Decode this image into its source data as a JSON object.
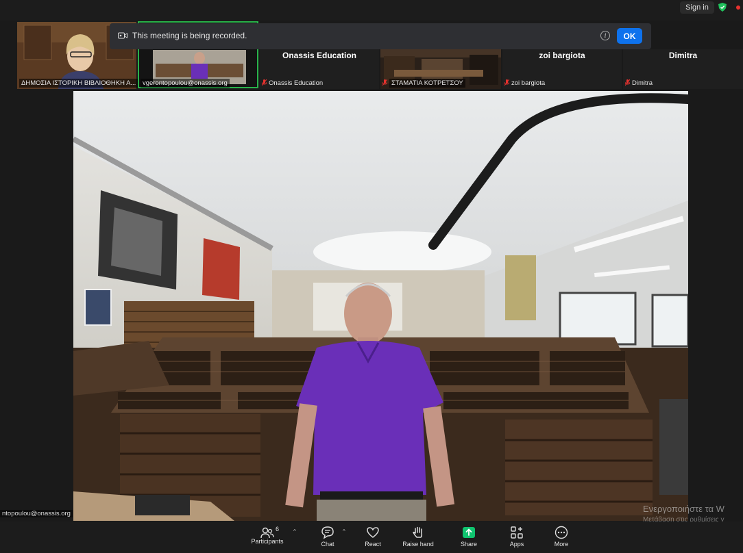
{
  "topbar": {
    "signin_label": "Sign in"
  },
  "recording_banner": {
    "message": "This meeting is being recorded.",
    "ok_label": "OK"
  },
  "participants_strip": [
    {
      "label": "ΔΗΜΟΣΙΑ ΙΣΤΟΡΙΚΗ ΒΙΒΛΙΟΘΗΚΗ Α..."
    },
    {
      "label": "vgerontopoulou@onassis.org"
    },
    {
      "big_name": "Onassis Education",
      "label": "Onassis Education"
    },
    {
      "label": "ΣΤΑΜΑΤΙΑ ΚΟΤΡΕΤΣΟΥ"
    },
    {
      "big_name": "zoi bargiota",
      "label": "zoi bargiota"
    },
    {
      "big_name": "Dimitra",
      "label": "Dimitra"
    }
  ],
  "active_speaker_tag": "ntopoulou@onassis.org",
  "windows_activation": {
    "line1": "Ενεργοποιήστε τα W",
    "line2": "Μετάβαση στις ρυθμίσεις γ"
  },
  "toolbar": {
    "participants_label": "Participants",
    "participants_count": "6",
    "chat_label": "Chat",
    "react_label": "React",
    "raise_hand_label": "Raise hand",
    "share_label": "Share",
    "apps_label": "Apps",
    "more_label": "More"
  },
  "colors": {
    "accent_blue": "#0e72ed",
    "share_green": "#0fc36f",
    "active_border": "#29b34a",
    "mute_red": "#e8322f",
    "shirt_purple": "#6a2fb8"
  }
}
